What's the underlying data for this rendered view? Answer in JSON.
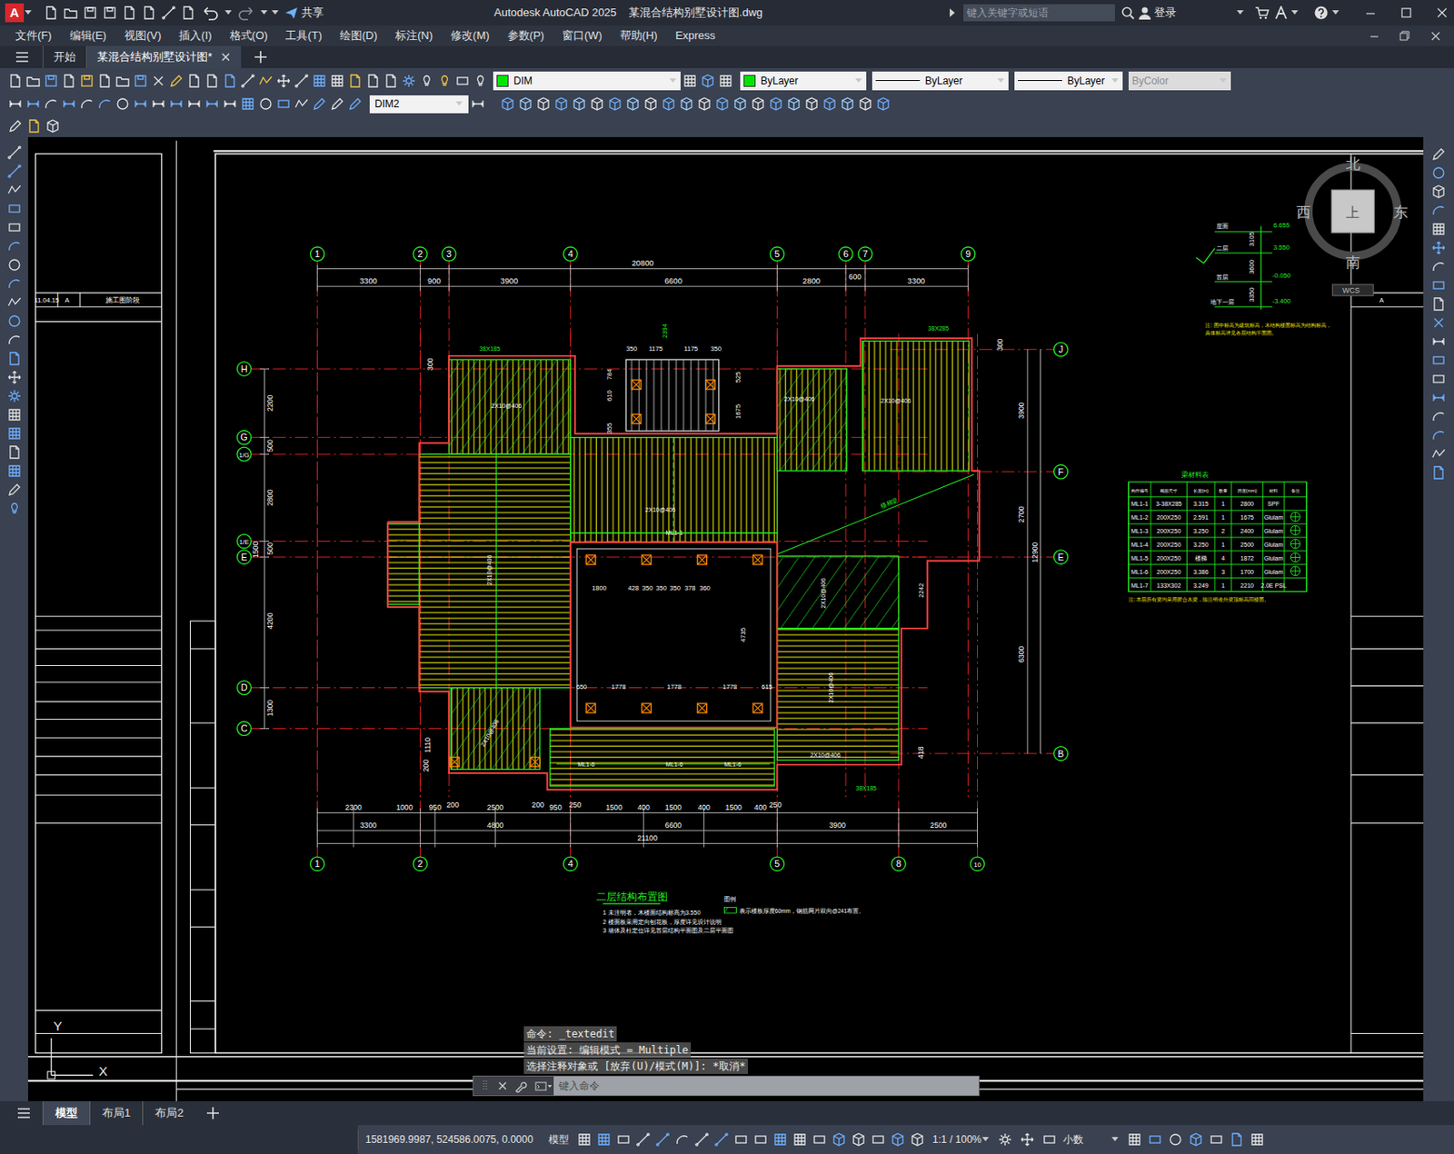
{
  "window": {
    "logo": "A",
    "share": "共享",
    "app": "Autodesk AutoCAD 2025",
    "document": "某混合结构别墅设计图.dwg",
    "search_placeholder": "键入关键字或短语",
    "login": "登录"
  },
  "menu": [
    "文件(F)",
    "编辑(E)",
    "视图(V)",
    "插入(I)",
    "格式(O)",
    "工具(T)",
    "绘图(D)",
    "标注(N)",
    "修改(M)",
    "参数(P)",
    "窗口(W)",
    "帮助(H)",
    "Express"
  ],
  "file_tabs": [
    {
      "label": "开始",
      "selected": false
    },
    {
      "label": "某混合结构别墅设计图*",
      "selected": true
    }
  ],
  "toolbar": {
    "layer": "DIM",
    "color": "ByLayer",
    "linetype": "ByLayer",
    "lineweight": "ByLayer",
    "plotstyle": "ByColor",
    "dimstyle": "DIM2"
  },
  "compass": {
    "north": "北",
    "south": "南",
    "west": "西",
    "east": "东",
    "top": "上",
    "ucs": "WCS"
  },
  "drawing": {
    "grid_top": [
      "1",
      "2",
      "3",
      "4",
      "5",
      "6",
      "7",
      "9"
    ],
    "grid_bottom": [
      "1",
      "2",
      "4",
      "5",
      "8",
      "10"
    ],
    "grid_left": [
      "H",
      "G",
      "1/G",
      "1/E",
      "E",
      "D",
      "C"
    ],
    "grid_right": [
      "J",
      "F",
      "E",
      "B"
    ],
    "dims_top": [
      "20800",
      "3300",
      "900",
      "3900",
      "6600",
      "2800",
      "600",
      "3300"
    ],
    "dims_bottom": [
      "2300",
      "1000",
      "950",
      "200",
      "2500",
      "200",
      "950",
      "250",
      "1500",
      "400",
      "1500",
      "400",
      "1500",
      "400",
      "250",
      "3300",
      "4800",
      "6600",
      "3900",
      "2500",
      "21100"
    ],
    "dims_left": [
      "2200",
      "500",
      "2800",
      "500",
      "1500",
      "4200",
      "1300",
      "300",
      "1110",
      "200"
    ],
    "dims_right": [
      "300",
      "3900",
      "2700",
      "12900",
      "6300",
      "418"
    ],
    "dims_inner": [
      "350",
      "1175",
      "1175",
      "350",
      "525",
      "1675",
      "784",
      "610",
      "355",
      "1800",
      "428",
      "350",
      "350",
      "350",
      "378",
      "360",
      "4735",
      "2242",
      "650",
      "1778",
      "1778",
      "1778",
      "615",
      "2394"
    ],
    "labels": [
      "38X185",
      "2X10@406",
      "2X10@406",
      "ML1-1",
      "38X285",
      "2X10@406",
      "2X10@406",
      "2X10@406",
      "楼梯梁",
      "2X10@406",
      "2X10@406",
      "2X10@406",
      "38X185",
      "2X10@406",
      "ML1-6",
      "ML1-6",
      "ML1-6"
    ],
    "elevation": {
      "levels": [
        "屋面",
        "二层",
        "首层",
        "地下一层"
      ],
      "values": [
        "6.655",
        "3.550",
        "-0.050",
        "-3.400"
      ],
      "dims": [
        "3105",
        "3600",
        "3350"
      ],
      "note": [
        "注: 图中标高为建筑标高，木结构楼面标高为结构标高，",
        "具体标高详见各层结构平面图。"
      ]
    },
    "table": {
      "title": "梁材料表",
      "columns": [
        "构件编号",
        "截面尺寸",
        "长度(m)",
        "数量",
        "跨度(mm)",
        "材料",
        "备注"
      ],
      "rows": [
        {
          "cells": [
            "ML1-1",
            "3-38X285",
            "3.315",
            "1",
            "2800",
            "SPF"
          ],
          "mark": false
        },
        {
          "cells": [
            "ML1-2",
            "200X250",
            "2.591",
            "1",
            "1675",
            "Glulam"
          ],
          "mark": true
        },
        {
          "cells": [
            "ML1-3",
            "200X250",
            "3.250",
            "2",
            "2400",
            "Glulam"
          ],
          "mark": true
        },
        {
          "cells": [
            "ML1-4",
            "200X250",
            "3.250",
            "1",
            "2500",
            "Glulam"
          ],
          "mark": true
        },
        {
          "cells": [
            "ML1-5",
            "200X250",
            "楼梯",
            "4",
            "1872",
            "Glulam"
          ],
          "mark": true
        },
        {
          "cells": [
            "ML1-6",
            "200X250",
            "3.386",
            "3",
            "1700",
            "Glulam"
          ],
          "mark": true
        },
        {
          "cells": [
            "ML1-7",
            "133X302",
            "3.249",
            "1",
            "2210",
            "2.0E PSL"
          ],
          "mark": false
        }
      ],
      "note": "注: 本层所有梁均采用胶合木梁，除注明者外梁顶标高同楼面。"
    },
    "plan_title": "二层结构布置图",
    "plan_notes": [
      "1 未注明者，木楼面结构标高为3.550",
      "2 楼面板采用定向刨花板，厚度详见设计说明",
      "3 墙体及柱定位详见首层结构平面图及二层平面图"
    ],
    "legend_title": "图例",
    "legend_text": "表示楼板厚度60mm，钢筋网片双向@241布置。",
    "title_block": [
      "11.04.15",
      "A",
      "施工图阶段"
    ],
    "title_block_right": [
      "A"
    ],
    "ucs": [
      "Y",
      "X"
    ]
  },
  "command_line": {
    "history": [
      "命令: _textedit",
      "当前设置: 编辑模式 = Multiple",
      "选择注释对象或 [放弃(U)/模式(M)]: *取消*"
    ],
    "placeholder": "键入命令"
  },
  "layout_tabs": [
    {
      "label": "模型",
      "selected": true
    },
    {
      "label": "布局1",
      "selected": false
    },
    {
      "label": "布局2",
      "selected": false
    }
  ],
  "status_bar": {
    "coordinates": "1581969.9987, 524586.0075, 0.0000",
    "space": "模型",
    "scale": "1:1 / 100%",
    "units": "小数"
  }
}
